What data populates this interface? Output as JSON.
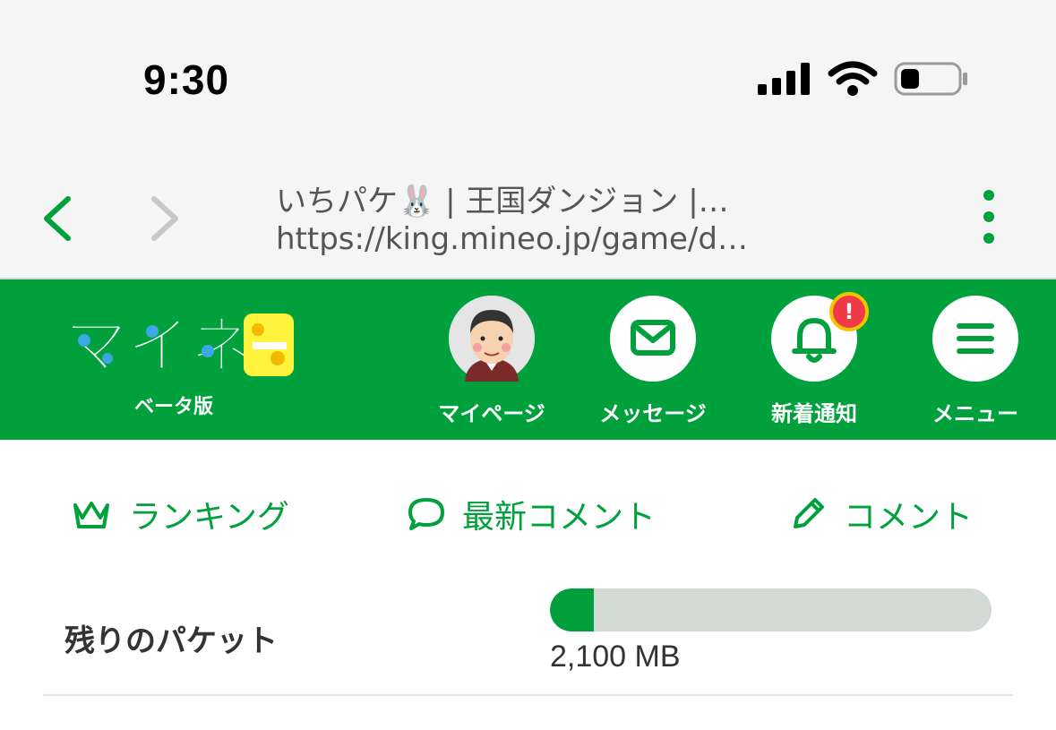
{
  "statusbar": {
    "time": "9:30"
  },
  "browser": {
    "page_title": "いちパケ🐰 | 王国ダンジョン |…",
    "url": "https://king.mineo.jp/game/d…"
  },
  "header": {
    "logo_subtitle": "ベータ版",
    "buttons": [
      {
        "label": "マイページ",
        "icon": "avatar"
      },
      {
        "label": "メッセージ",
        "icon": "envelope-icon"
      },
      {
        "label": "新着通知",
        "icon": "bell-icon",
        "badge": "!"
      },
      {
        "label": "メニュー",
        "icon": "hamburger-icon"
      }
    ]
  },
  "quicknav": [
    {
      "label": "ランキング",
      "icon": "crown-icon"
    },
    {
      "label": "最新コメント",
      "icon": "speech-bubble-icon"
    },
    {
      "label": "コメント",
      "icon": "pencil-icon"
    }
  ],
  "packet": {
    "label": "残りのパケット",
    "value": "2,100 MB",
    "fill_fraction": 0.1
  },
  "colors": {
    "brand_green": "#00a13c",
    "alert_red": "#ef3b48",
    "bar_track": "#d3dad5"
  }
}
